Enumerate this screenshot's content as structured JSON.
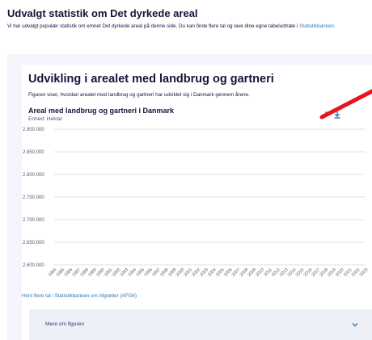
{
  "page": {
    "title": "Udvalgt statistik om Det dyrkede areal",
    "intro_text": "Vi har udvalgt populær statistik om emnet Det dyrkede areal på denne side. Du kan finde flere tal og lave dine egne tabeludtræk i ",
    "intro_link": "Statistikbanken."
  },
  "section": {
    "title": "Udvikling i arealet med landbrug og gartneri",
    "description": "Figuren viser, hvordan arealet med landbrug og gartneri har udviklet sig i Danmark gennem årene.",
    "chart_title": "Areal med landbrug og gartneri i Danmark",
    "unit": "Enhed: Hektar",
    "expand_icon": "expand-icon",
    "download_icon": "download-icon",
    "source_link": "Hent flere tal i Statistikbanken om Afgrøder (AFG6)",
    "accordion_label": "Mere om figuren",
    "accordion_icon": "chevron-down-icon"
  },
  "colors": {
    "brand_dark": "#14143c",
    "link_blue": "#2e7ab6",
    "card_background": "#f4f6fb",
    "accordion_background": "#edf0f7",
    "gridline": "#d6d9e0",
    "annotation_red": "#e8141b"
  },
  "chart_data": {
    "type": "line",
    "title": "Areal med landbrug og gartneri i Danmark",
    "subtitle": "Enhed: Hektar",
    "ylim": [
      2600000,
      2900000
    ],
    "y_ticks": [
      "2.900.000",
      "2.850.000",
      "2.800.000",
      "2.750.000",
      "2.700.000",
      "2.650.000",
      "2.600.000"
    ],
    "x_ticks": [
      "1984",
      "1985",
      "1986",
      "1987",
      "1988",
      "1989",
      "1990",
      "1991",
      "1992",
      "1993",
      "1994",
      "1995",
      "1996",
      "1997",
      "1998",
      "1999",
      "2000",
      "2001",
      "2002",
      "2003",
      "2004",
      "2005",
      "2006",
      "2007",
      "2008",
      "2009",
      "2010",
      "2011",
      "2012",
      "2013",
      "2014",
      "2015",
      "2016",
      "2017",
      "2018",
      "2019",
      "2020",
      "2021",
      "2022",
      "2023"
    ],
    "grid": true,
    "series": []
  }
}
